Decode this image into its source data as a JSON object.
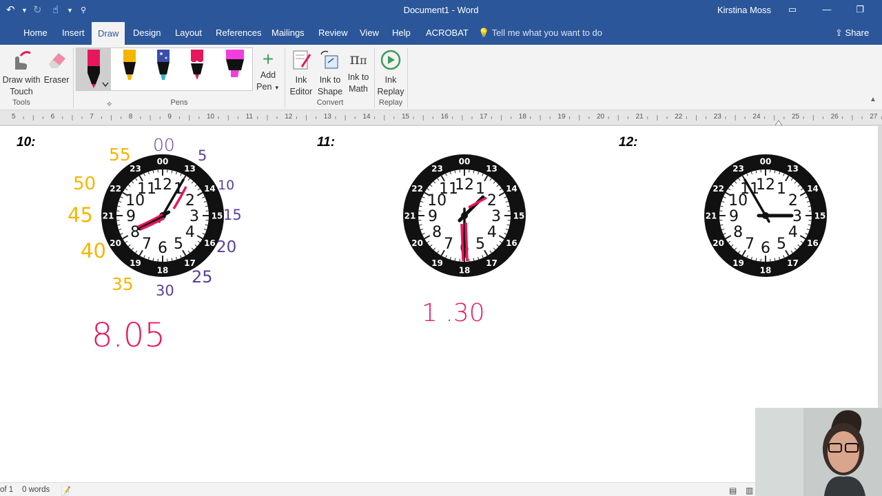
{
  "titlebar": {
    "doc_title": "Document1  -  Word",
    "user": "Kirstina Moss"
  },
  "tabs": [
    "Home",
    "Insert",
    "Draw",
    "Design",
    "Layout",
    "References",
    "Mailings",
    "Review",
    "View",
    "Help",
    "ACROBAT"
  ],
  "active_tab": "Draw",
  "tell_me": "Tell me what you want to do",
  "share_label": "Share",
  "ribbon": {
    "draw_touch": [
      "Draw with",
      "Touch"
    ],
    "eraser": "Eraser",
    "tools_label": "Tools",
    "pens_label": "Pens",
    "add_pen": [
      "Add",
      "Pen"
    ],
    "ink_editor": [
      "Ink",
      "Editor"
    ],
    "ink_to_shape": [
      "Ink to",
      "Shape"
    ],
    "ink_to_math": [
      "Ink to",
      "Math"
    ],
    "convert_label": "Convert",
    "ink_replay": [
      "Ink",
      "Replay"
    ],
    "replay_label": "Replay",
    "pens": [
      {
        "name": "pink-pen",
        "color": "#e8175d",
        "selected": true
      },
      {
        "name": "yellow-highlighter",
        "color": "#f5b600"
      },
      {
        "name": "galaxy-pen",
        "color": "#4a6fd8"
      },
      {
        "name": "red-pen",
        "color": "#e8175d"
      },
      {
        "name": "magenta-highlighter",
        "color": "#f23ee0"
      }
    ]
  },
  "ruler": {
    "numbers": [
      "5",
      "6",
      "7",
      "8",
      "9",
      "10",
      "11",
      "12",
      "13",
      "14",
      "15",
      "16",
      "17",
      "18",
      "19",
      "20",
      "21",
      "22",
      "23",
      "24",
      "25",
      "26",
      "27"
    ]
  },
  "document": {
    "questions": [
      "10:",
      "11:",
      "12:"
    ],
    "clocks": [
      {
        "label": "10",
        "hour_hand_deg": 240,
        "minute_hand_deg": 30
      },
      {
        "label": "11",
        "hour_hand_deg": 45,
        "minute_hand_deg": 180
      },
      {
        "label": "12",
        "hour_hand_deg": 90,
        "minute_hand_deg": 330
      }
    ],
    "clock_numbers": [
      "12",
      "1",
      "2",
      "3",
      "4",
      "5",
      "6",
      "7",
      "8",
      "9",
      "10",
      "11"
    ],
    "clock_24h": [
      "00",
      "13",
      "14",
      "15",
      "16",
      "17",
      "18",
      "19",
      "20",
      "21",
      "22",
      "23"
    ],
    "ink_answers": [
      "8.05",
      "1 .30"
    ],
    "ink_minutes_purple": [
      "00",
      "5",
      "10",
      "15",
      "20",
      "25",
      "30"
    ],
    "ink_minutes_yellow": [
      "55",
      "50",
      "45",
      "40",
      "35"
    ]
  },
  "statusbar": {
    "page": "of 1",
    "words": "0 words"
  },
  "colors": {
    "word_blue": "#2b579a",
    "ink_pink": "#e8175d",
    "ink_purple": "#5a3f9b",
    "ink_yellow": "#f5b600"
  }
}
